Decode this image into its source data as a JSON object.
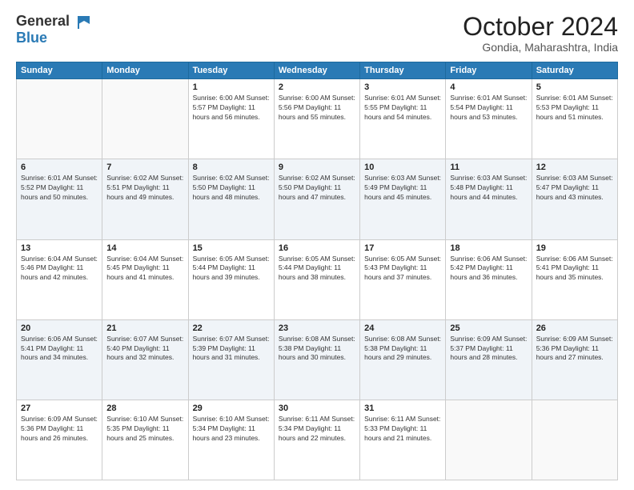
{
  "header": {
    "logo_line1": "General",
    "logo_line2": "Blue",
    "month": "October 2024",
    "location": "Gondia, Maharashtra, India"
  },
  "weekdays": [
    "Sunday",
    "Monday",
    "Tuesday",
    "Wednesday",
    "Thursday",
    "Friday",
    "Saturday"
  ],
  "weeks": [
    [
      {
        "day": "",
        "info": ""
      },
      {
        "day": "",
        "info": ""
      },
      {
        "day": "1",
        "info": "Sunrise: 6:00 AM\nSunset: 5:57 PM\nDaylight: 11 hours\nand 56 minutes."
      },
      {
        "day": "2",
        "info": "Sunrise: 6:00 AM\nSunset: 5:56 PM\nDaylight: 11 hours\nand 55 minutes."
      },
      {
        "day": "3",
        "info": "Sunrise: 6:01 AM\nSunset: 5:55 PM\nDaylight: 11 hours\nand 54 minutes."
      },
      {
        "day": "4",
        "info": "Sunrise: 6:01 AM\nSunset: 5:54 PM\nDaylight: 11 hours\nand 53 minutes."
      },
      {
        "day": "5",
        "info": "Sunrise: 6:01 AM\nSunset: 5:53 PM\nDaylight: 11 hours\nand 51 minutes."
      }
    ],
    [
      {
        "day": "6",
        "info": "Sunrise: 6:01 AM\nSunset: 5:52 PM\nDaylight: 11 hours\nand 50 minutes."
      },
      {
        "day": "7",
        "info": "Sunrise: 6:02 AM\nSunset: 5:51 PM\nDaylight: 11 hours\nand 49 minutes."
      },
      {
        "day": "8",
        "info": "Sunrise: 6:02 AM\nSunset: 5:50 PM\nDaylight: 11 hours\nand 48 minutes."
      },
      {
        "day": "9",
        "info": "Sunrise: 6:02 AM\nSunset: 5:50 PM\nDaylight: 11 hours\nand 47 minutes."
      },
      {
        "day": "10",
        "info": "Sunrise: 6:03 AM\nSunset: 5:49 PM\nDaylight: 11 hours\nand 45 minutes."
      },
      {
        "day": "11",
        "info": "Sunrise: 6:03 AM\nSunset: 5:48 PM\nDaylight: 11 hours\nand 44 minutes."
      },
      {
        "day": "12",
        "info": "Sunrise: 6:03 AM\nSunset: 5:47 PM\nDaylight: 11 hours\nand 43 minutes."
      }
    ],
    [
      {
        "day": "13",
        "info": "Sunrise: 6:04 AM\nSunset: 5:46 PM\nDaylight: 11 hours\nand 42 minutes."
      },
      {
        "day": "14",
        "info": "Sunrise: 6:04 AM\nSunset: 5:45 PM\nDaylight: 11 hours\nand 41 minutes."
      },
      {
        "day": "15",
        "info": "Sunrise: 6:05 AM\nSunset: 5:44 PM\nDaylight: 11 hours\nand 39 minutes."
      },
      {
        "day": "16",
        "info": "Sunrise: 6:05 AM\nSunset: 5:44 PM\nDaylight: 11 hours\nand 38 minutes."
      },
      {
        "day": "17",
        "info": "Sunrise: 6:05 AM\nSunset: 5:43 PM\nDaylight: 11 hours\nand 37 minutes."
      },
      {
        "day": "18",
        "info": "Sunrise: 6:06 AM\nSunset: 5:42 PM\nDaylight: 11 hours\nand 36 minutes."
      },
      {
        "day": "19",
        "info": "Sunrise: 6:06 AM\nSunset: 5:41 PM\nDaylight: 11 hours\nand 35 minutes."
      }
    ],
    [
      {
        "day": "20",
        "info": "Sunrise: 6:06 AM\nSunset: 5:41 PM\nDaylight: 11 hours\nand 34 minutes."
      },
      {
        "day": "21",
        "info": "Sunrise: 6:07 AM\nSunset: 5:40 PM\nDaylight: 11 hours\nand 32 minutes."
      },
      {
        "day": "22",
        "info": "Sunrise: 6:07 AM\nSunset: 5:39 PM\nDaylight: 11 hours\nand 31 minutes."
      },
      {
        "day": "23",
        "info": "Sunrise: 6:08 AM\nSunset: 5:38 PM\nDaylight: 11 hours\nand 30 minutes."
      },
      {
        "day": "24",
        "info": "Sunrise: 6:08 AM\nSunset: 5:38 PM\nDaylight: 11 hours\nand 29 minutes."
      },
      {
        "day": "25",
        "info": "Sunrise: 6:09 AM\nSunset: 5:37 PM\nDaylight: 11 hours\nand 28 minutes."
      },
      {
        "day": "26",
        "info": "Sunrise: 6:09 AM\nSunset: 5:36 PM\nDaylight: 11 hours\nand 27 minutes."
      }
    ],
    [
      {
        "day": "27",
        "info": "Sunrise: 6:09 AM\nSunset: 5:36 PM\nDaylight: 11 hours\nand 26 minutes."
      },
      {
        "day": "28",
        "info": "Sunrise: 6:10 AM\nSunset: 5:35 PM\nDaylight: 11 hours\nand 25 minutes."
      },
      {
        "day": "29",
        "info": "Sunrise: 6:10 AM\nSunset: 5:34 PM\nDaylight: 11 hours\nand 23 minutes."
      },
      {
        "day": "30",
        "info": "Sunrise: 6:11 AM\nSunset: 5:34 PM\nDaylight: 11 hours\nand 22 minutes."
      },
      {
        "day": "31",
        "info": "Sunrise: 6:11 AM\nSunset: 5:33 PM\nDaylight: 11 hours\nand 21 minutes."
      },
      {
        "day": "",
        "info": ""
      },
      {
        "day": "",
        "info": ""
      }
    ]
  ]
}
